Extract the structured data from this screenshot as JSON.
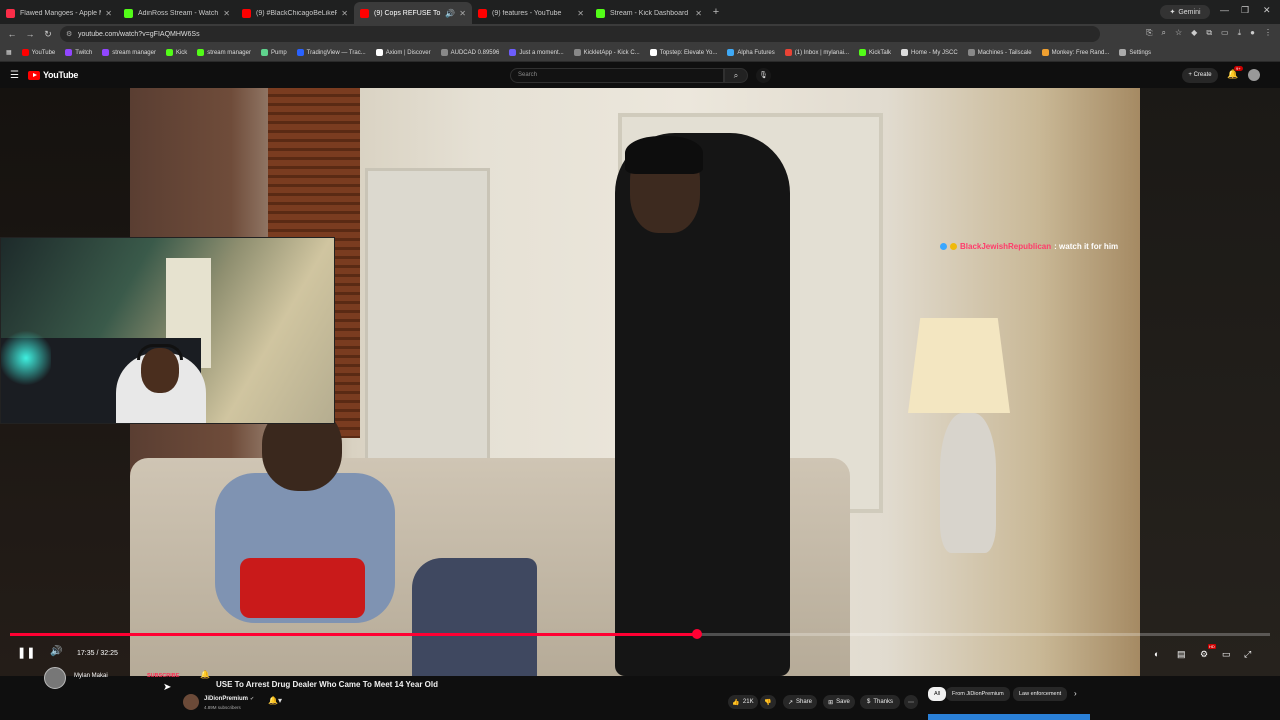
{
  "browser": {
    "tabs": [
      {
        "title": "Flawed Mangoes - Apple Music",
        "color": "#fa2d48"
      },
      {
        "title": "AdinRoss Stream - Watch Live",
        "color": "#53fc18"
      },
      {
        "title": "(9) #BlackChicagoBeLikePart12",
        "color": "#ff0000"
      },
      {
        "title": "(9) Cops REFUSE To Arrest",
        "color": "#ff0000",
        "active": true
      },
      {
        "title": "(9) features - YouTube",
        "color": "#ff0000"
      },
      {
        "title": "Stream - Kick Dashboard",
        "color": "#53fc18"
      }
    ],
    "new_tab": "+",
    "gemini_label": "Gemini",
    "url": "youtube.com/watch?v=gFIAQMHW6Ss",
    "bookmarks": [
      {
        "label": "YouTube",
        "color": "#ff0000"
      },
      {
        "label": "Twitch",
        "color": "#9146ff"
      },
      {
        "label": "stream manager",
        "color": "#9146ff"
      },
      {
        "label": "Kick",
        "color": "#53fc18"
      },
      {
        "label": "stream manager",
        "color": "#53fc18"
      },
      {
        "label": "Pump",
        "color": "#5fd38d"
      },
      {
        "label": "TradingView — Trac...",
        "color": "#2962ff"
      },
      {
        "label": "Axiom | Discover",
        "color": "#ffffff"
      },
      {
        "label": "AUDCAD 0.89596",
        "color": "#888888"
      },
      {
        "label": "Just a moment...",
        "color": "#6d5dfc"
      },
      {
        "label": "KickletApp - Kick C...",
        "color": "#888888"
      },
      {
        "label": "Topstep: Elevate Yo...",
        "color": "#ffffff"
      },
      {
        "label": "Alpha Futures",
        "color": "#3fa9f5"
      },
      {
        "label": "(1) Inbox | mylanai...",
        "color": "#ea4335"
      },
      {
        "label": "KickTalk",
        "color": "#53fc18"
      },
      {
        "label": "Home - My JSCC",
        "color": "#dddddd"
      },
      {
        "label": "Machines - Tailscale",
        "color": "#888888"
      },
      {
        "label": "Monkey: Free Rand...",
        "color": "#f0a030"
      },
      {
        "label": "Settings",
        "color": "#aaaaaa"
      }
    ]
  },
  "youtube": {
    "logo_text": "YouTube",
    "search_placeholder": "Search",
    "create_label": "Create",
    "notif_count": "9+"
  },
  "player": {
    "chat_user": "BlackJewishRepublican",
    "chat_message": ": watch it for him",
    "progress": 0.545,
    "current_time": "17:35",
    "duration": "32:25",
    "time_display": "17:35 / 32:25",
    "hd_badge": "HD"
  },
  "streamer": {
    "name": "Mylan Makai",
    "subscribe_label": "SUBSCRIBE"
  },
  "video": {
    "title": "USE To Arrest Drug Dealer Who Came To Meet 14 Year Old",
    "channel": "JiDionPremium",
    "subs": "4.89M subscribers",
    "likes": "21K",
    "share": "Share",
    "save": "Save",
    "thanks": "Thanks",
    "chips": [
      "All",
      "From JiDionPremium",
      "Law enforcement"
    ]
  },
  "colors": {
    "accent_red": "#ff0033",
    "yt_bg": "#0f0f0f"
  }
}
